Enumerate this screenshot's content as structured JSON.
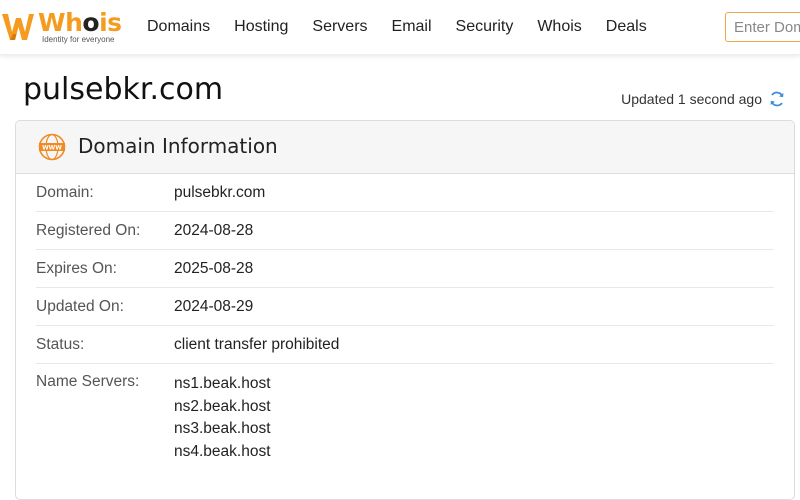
{
  "brand": {
    "name_accent": "Wh",
    "name_dark": "o",
    "name_end": "is",
    "tagline": "Identity for everyone",
    "accent_color": "#f59b20"
  },
  "nav": {
    "items": [
      {
        "label": "Domains"
      },
      {
        "label": "Hosting"
      },
      {
        "label": "Servers"
      },
      {
        "label": "Email"
      },
      {
        "label": "Security"
      },
      {
        "label": "Whois"
      },
      {
        "label": "Deals"
      }
    ]
  },
  "search": {
    "placeholder": "Enter Domain"
  },
  "page": {
    "title": "pulsebkr.com",
    "updated_text": "Updated 1 second ago"
  },
  "card": {
    "title": "Domain Information",
    "icon": "www-icon",
    "rows": [
      {
        "label": "Domain:",
        "value": "pulsebkr.com"
      },
      {
        "label": "Registered On:",
        "value": "2024-08-28"
      },
      {
        "label": "Expires On:",
        "value": "2025-08-28"
      },
      {
        "label": "Updated On:",
        "value": "2024-08-29"
      },
      {
        "label": "Status:",
        "value": "client transfer prohibited"
      }
    ],
    "name_servers": {
      "label": "Name Servers:",
      "values": [
        "ns1.beak.host",
        "ns2.beak.host",
        "ns3.beak.host",
        "ns4.beak.host"
      ]
    }
  }
}
